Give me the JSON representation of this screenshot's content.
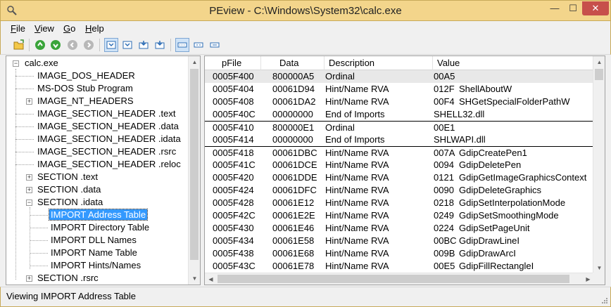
{
  "window": {
    "title": "PEview - C:\\Windows\\System32\\calc.exe",
    "minimize_label": "—",
    "maximize_label": "☐",
    "close_label": "✕"
  },
  "menu": {
    "items": [
      {
        "key": "F",
        "rest": "ile"
      },
      {
        "key": "V",
        "rest": "iew"
      },
      {
        "key": "G",
        "rest": "o"
      },
      {
        "key": "H",
        "rest": "elp"
      }
    ]
  },
  "toolbar": {
    "icons": [
      "open-file-icon",
      "back-icon",
      "forward-icon",
      "back-disabled-icon",
      "forward-disabled-icon",
      "view-1-icon",
      "view-2-icon",
      "view-3-icon",
      "view-4-icon",
      "byte-view-icon",
      "word-view-icon",
      "dword-view-icon"
    ]
  },
  "tree": {
    "root": "calc.exe",
    "items": [
      {
        "label": "IMAGE_DOS_HEADER"
      },
      {
        "label": "MS-DOS Stub Program"
      },
      {
        "label": "IMAGE_NT_HEADERS"
      },
      {
        "label": "IMAGE_SECTION_HEADER .text"
      },
      {
        "label": "IMAGE_SECTION_HEADER .data"
      },
      {
        "label": "IMAGE_SECTION_HEADER .idata"
      },
      {
        "label": "IMAGE_SECTION_HEADER .rsrc"
      },
      {
        "label": "IMAGE_SECTION_HEADER .reloc"
      },
      {
        "label": "SECTION .text"
      },
      {
        "label": "SECTION .data"
      },
      {
        "label": "SECTION .idata"
      },
      {
        "label": "IMPORT Address Table"
      },
      {
        "label": "IMPORT Directory Table"
      },
      {
        "label": "IMPORT DLL Names"
      },
      {
        "label": "IMPORT Name Table"
      },
      {
        "label": "IMPORT Hints/Names"
      },
      {
        "label": "SECTION .rsrc"
      }
    ]
  },
  "table": {
    "columns": [
      "pFile",
      "Data",
      "Description",
      "Value"
    ],
    "rows": [
      {
        "pfile": "0005F400",
        "data": "800000A5",
        "desc": "Ordinal",
        "v1": "00A5",
        "v2": ""
      },
      {
        "pfile": "0005F404",
        "data": "00061D94",
        "desc": "Hint/Name RVA",
        "v1": "012F",
        "v2": "ShellAboutW"
      },
      {
        "pfile": "0005F408",
        "data": "00061DA2",
        "desc": "Hint/Name RVA",
        "v1": "00F4",
        "v2": "SHGetSpecialFolderPathW"
      },
      {
        "pfile": "0005F40C",
        "data": "00000000",
        "desc": "End of Imports",
        "v1": "SHELL32.dll",
        "v2": ""
      },
      {
        "pfile": "0005F410",
        "data": "800000E1",
        "desc": "Ordinal",
        "v1": "00E1",
        "v2": ""
      },
      {
        "pfile": "0005F414",
        "data": "00000000",
        "desc": "End of Imports",
        "v1": "SHLWAPI.dll",
        "v2": ""
      },
      {
        "pfile": "0005F418",
        "data": "00061DBC",
        "desc": "Hint/Name RVA",
        "v1": "007A",
        "v2": "GdipCreatePen1"
      },
      {
        "pfile": "0005F41C",
        "data": "00061DCE",
        "desc": "Hint/Name RVA",
        "v1": "0094",
        "v2": "GdipDeletePen"
      },
      {
        "pfile": "0005F420",
        "data": "00061DDE",
        "desc": "Hint/Name RVA",
        "v1": "0121",
        "v2": "GdipGetImageGraphicsContext"
      },
      {
        "pfile": "0005F424",
        "data": "00061DFC",
        "desc": "Hint/Name RVA",
        "v1": "0090",
        "v2": "GdipDeleteGraphics"
      },
      {
        "pfile": "0005F428",
        "data": "00061E12",
        "desc": "Hint/Name RVA",
        "v1": "0218",
        "v2": "GdipSetInterpolationMode"
      },
      {
        "pfile": "0005F42C",
        "data": "00061E2E",
        "desc": "Hint/Name RVA",
        "v1": "0249",
        "v2": "GdipSetSmoothingMode"
      },
      {
        "pfile": "0005F430",
        "data": "00061E46",
        "desc": "Hint/Name RVA",
        "v1": "0224",
        "v2": "GdipSetPageUnit"
      },
      {
        "pfile": "0005F434",
        "data": "00061E58",
        "desc": "Hint/Name RVA",
        "v1": "00BC",
        "v2": "GdipDrawLineI"
      },
      {
        "pfile": "0005F438",
        "data": "00061E68",
        "desc": "Hint/Name RVA",
        "v1": "009B",
        "v2": "GdipDrawArcI"
      },
      {
        "pfile": "0005F43C",
        "data": "00061E78",
        "desc": "Hint/Name RVA",
        "v1": "00E5",
        "v2": "GdipFillRectangleI"
      }
    ]
  },
  "status": {
    "text": "Viewing IMPORT Address Table"
  },
  "colors": {
    "title_bar": "#f3d58b",
    "selection": "#3399ff",
    "close_button": "#c7504b"
  }
}
